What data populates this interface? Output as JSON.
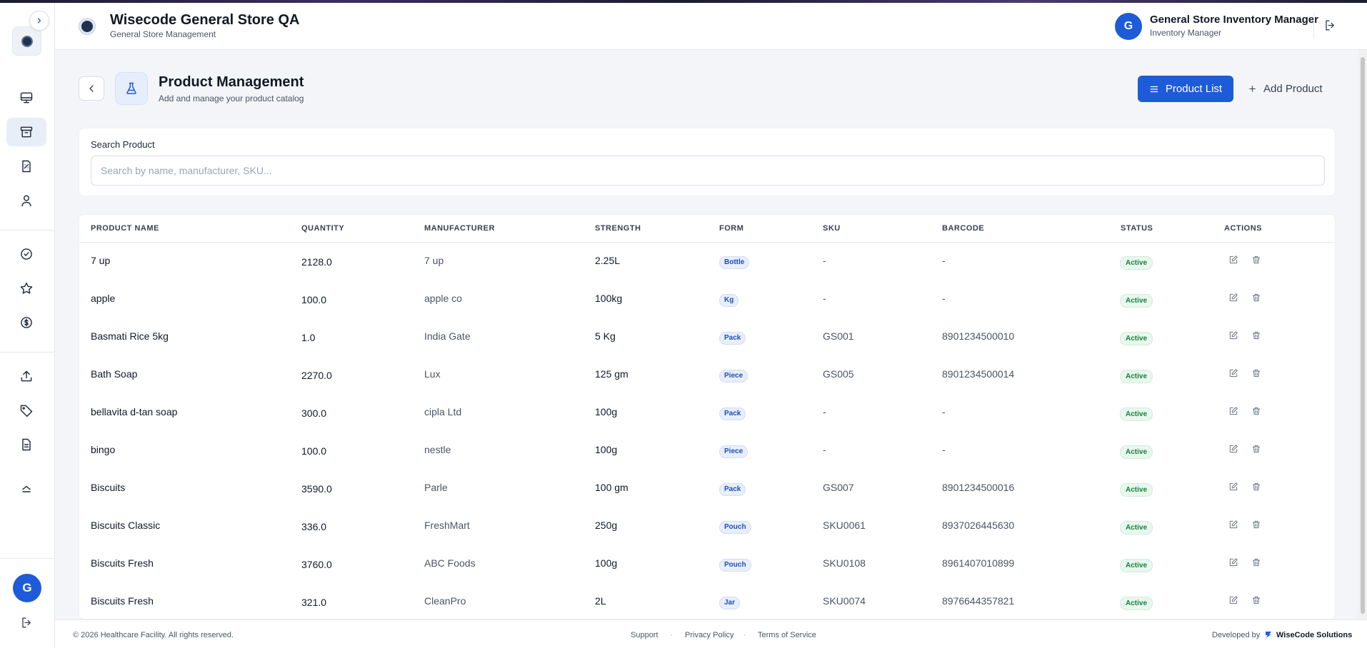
{
  "app": {
    "title": "Wisecode General Store QA",
    "subtitle": "General Store Management"
  },
  "user": {
    "initial": "G",
    "name": "General Store Inventory Manager",
    "role": "Inventory Manager"
  },
  "sidebar": {
    "items": [
      {
        "icon": "monitor-icon",
        "active": false
      },
      {
        "icon": "archive-icon",
        "active": true
      },
      {
        "icon": "receipt-icon",
        "active": false
      },
      {
        "icon": "user-icon",
        "active": false
      },
      {
        "icon": "check-circle-icon",
        "active": false
      },
      {
        "icon": "star-icon",
        "active": false
      },
      {
        "icon": "dollar-circle-icon",
        "active": false
      },
      {
        "icon": "upload-icon",
        "active": false
      },
      {
        "icon": "tag-icon",
        "active": false
      },
      {
        "icon": "file-text-icon",
        "active": false
      },
      {
        "icon": "chevron-up-icon",
        "active": false
      }
    ],
    "avatar_initial": "G"
  },
  "page": {
    "title": "Product Management",
    "subtitle": "Add and manage your product catalog",
    "product_list_label": "Product List",
    "add_product_label": "Add Product"
  },
  "search": {
    "label": "Search Product",
    "placeholder": "Search by name, manufacturer, SKU...",
    "value": ""
  },
  "table": {
    "headers": {
      "name": "PRODUCT NAME",
      "quantity": "QUANTITY",
      "manufacturer": "MANUFACTURER",
      "strength": "STRENGTH",
      "form": "FORM",
      "sku": "SKU",
      "barcode": "BARCODE",
      "status": "STATUS",
      "actions": "ACTIONS"
    },
    "rows": [
      {
        "name": "7 up",
        "quantity": "2128.0",
        "manufacturer": "7 up",
        "strength": "2.25L",
        "form": "Bottle",
        "sku": "-",
        "barcode": "-",
        "status": "Active"
      },
      {
        "name": "apple",
        "quantity": "100.0",
        "manufacturer": "apple co",
        "strength": "100kg",
        "form": "Kg",
        "sku": "-",
        "barcode": "-",
        "status": "Active"
      },
      {
        "name": "Basmati Rice 5kg",
        "quantity": "1.0",
        "manufacturer": "India Gate",
        "strength": "5 Kg",
        "form": "Pack",
        "sku": "GS001",
        "barcode": "8901234500010",
        "status": "Active"
      },
      {
        "name": "Bath Soap",
        "quantity": "2270.0",
        "manufacturer": "Lux",
        "strength": "125 gm",
        "form": "Piece",
        "sku": "GS005",
        "barcode": "8901234500014",
        "status": "Active"
      },
      {
        "name": "bellavita d-tan soap",
        "quantity": "300.0",
        "manufacturer": "cipla Ltd",
        "strength": "100g",
        "form": "Pack",
        "sku": "-",
        "barcode": "-",
        "status": "Active"
      },
      {
        "name": "bingo",
        "quantity": "100.0",
        "manufacturer": "nestle",
        "strength": "100g",
        "form": "Piece",
        "sku": "-",
        "barcode": "-",
        "status": "Active"
      },
      {
        "name": "Biscuits",
        "quantity": "3590.0",
        "manufacturer": "Parle",
        "strength": "100 gm",
        "form": "Pack",
        "sku": "GS007",
        "barcode": "8901234500016",
        "status": "Active"
      },
      {
        "name": "Biscuits Classic",
        "quantity": "336.0",
        "manufacturer": "FreshMart",
        "strength": "250g",
        "form": "Pouch",
        "sku": "SKU0061",
        "barcode": "8937026445630",
        "status": "Active"
      },
      {
        "name": "Biscuits Fresh",
        "quantity": "3760.0",
        "manufacturer": "ABC Foods",
        "strength": "100g",
        "form": "Pouch",
        "sku": "SKU0108",
        "barcode": "8961407010899",
        "status": "Active"
      },
      {
        "name": "Biscuits Fresh",
        "quantity": "321.0",
        "manufacturer": "CleanPro",
        "strength": "2L",
        "form": "Jar",
        "sku": "SKU0074",
        "barcode": "8976644357821",
        "status": "Active"
      }
    ]
  },
  "footer": {
    "copyright": "© 2026 Healthcare Facility. All rights reserved.",
    "support": "Support",
    "privacy": "Privacy Policy",
    "terms": "Terms of Service",
    "developed_by": "Developed by",
    "brand": "WiseCode Solutions"
  },
  "colors": {
    "primary": "#1d5bd8",
    "status_active_text": "#15803d",
    "status_active_bg": "#e9f7ee",
    "form_pill_text": "#1d4fb8",
    "form_pill_bg": "#e8eefb"
  }
}
